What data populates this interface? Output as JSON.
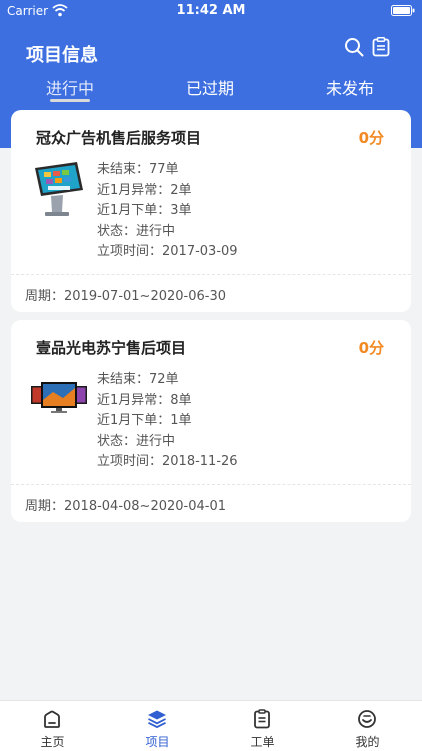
{
  "status_bar": {
    "carrier": "Carrier",
    "time": "11:42 AM"
  },
  "header": {
    "title": "项目信息",
    "search_icon": "search-icon",
    "clipboard_icon": "clipboard-icon"
  },
  "tabs": [
    {
      "label": "进行中",
      "active": true
    },
    {
      "label": "已过期",
      "active": false
    },
    {
      "label": "未发布",
      "active": false
    }
  ],
  "projects": [
    {
      "title": "冠众广告机售后服务项目",
      "score": "0分",
      "thumbnail": "kiosk-image",
      "unfinished": "未结束：77单",
      "abnormal": "近1月异常：2单",
      "orders": "近1月下单：3单",
      "status": "状态：进行中",
      "established": "立项时间：2017-03-09",
      "period": "周期：2019-07-01~2020-06-30"
    },
    {
      "title": "壹品光电苏宁售后项目",
      "score": "0分",
      "thumbnail": "tv-image",
      "unfinished": "未结束：72单",
      "abnormal": "近1月异常：8单",
      "orders": "近1月下单：1单",
      "status": "状态：进行中",
      "established": "立项时间：2018-11-26",
      "period": "周期：2018-04-08~2020-04-01"
    }
  ],
  "tabbar": [
    {
      "label": "主页",
      "icon": "home-icon",
      "active": false
    },
    {
      "label": "项目",
      "icon": "layers-icon",
      "active": true
    },
    {
      "label": "工单",
      "icon": "clipboard-list-icon",
      "active": false
    },
    {
      "label": "我的",
      "icon": "smiley-icon",
      "active": false
    }
  ],
  "colors": {
    "header_blue": "#3d6fe0",
    "score_orange": "#f28a24",
    "active_tab_blue": "#2f5fd0"
  }
}
